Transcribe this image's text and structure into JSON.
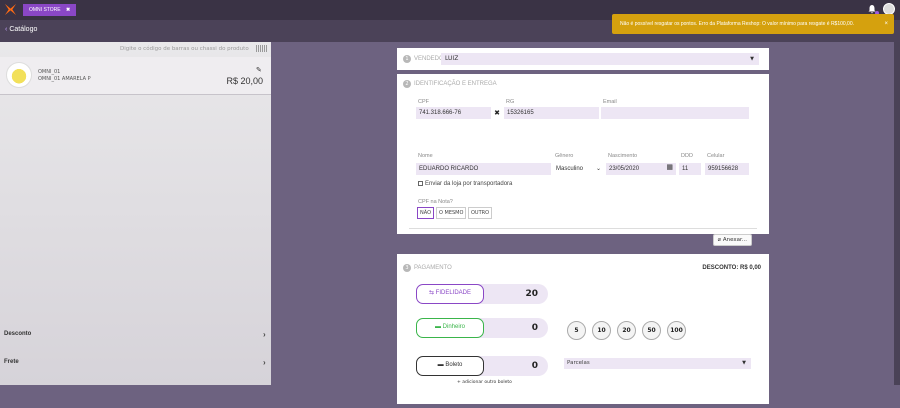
{
  "header": {
    "store_tab": "OMNI STORE",
    "store_tab_close": "✖",
    "back_label": "Catálogo",
    "back_chevron": "‹",
    "toast_message": "Não é possível resgatar os pontos. Erro da Plataforma Reshop: O valor mínimo para resgate é R$100,00.",
    "toast_close": "×"
  },
  "left": {
    "barcode_placeholder": "Digite o código de barras ou chassi do produto",
    "product": {
      "name": "OMNI_01",
      "variant": "OMNI_01 AMARELA P",
      "price": "R$ 20,00",
      "edit_icon": "✎"
    },
    "rows": [
      {
        "label": "Desconto",
        "chevron": "›"
      },
      {
        "label": "Frete",
        "chevron": "›"
      }
    ]
  },
  "vendor": {
    "step": "1",
    "title": "VENDEDOR",
    "value": "LUIZ"
  },
  "ident": {
    "step": "2",
    "title": "IDENTIFICAÇÃO E ENTREGA",
    "cpf_label": "CPF",
    "cpf_value": "741.318.666-76",
    "clear_icon": "✖",
    "rg_label": "RG",
    "rg_value": "15326165",
    "email_label": "Email",
    "email_value": "",
    "nome_label": "Nome",
    "nome_value": "EDUARDO RICARDO",
    "genero_label": "Gênero",
    "genero_value": "Masculino",
    "nascimento_label": "Nascimento",
    "nascimento_value": "23/05/2020",
    "ddd_label": "DDD",
    "ddd_value": "11",
    "celular_label": "Celular",
    "celular_value": "959156628",
    "transport_label": "Enviar da loja por transportadora",
    "cpf_nota_label": "CPF na Nota?",
    "cpf_nota_options": [
      "NÃO",
      "O MESMO",
      "OUTRO"
    ],
    "cpf_nota_selected": "NÃO",
    "anexar_label": "Anexar..."
  },
  "payment": {
    "step": "3",
    "title": "PAGAMENTO",
    "desconto": "DESCONTO: R$ 0,00",
    "methods": [
      {
        "label": "FIDELIDADE",
        "value": "20",
        "icon": "⇆",
        "color": "#8a47c6"
      },
      {
        "label": "Dinheiro",
        "value": "0",
        "icon": "▬",
        "color": "#3ab54a"
      },
      {
        "label": "Boleto",
        "value": "0",
        "icon": "▬",
        "color": "#333333"
      }
    ],
    "quick_amounts": [
      "5",
      "10",
      "20",
      "50",
      "100"
    ],
    "parcelas_label": "Parcelas",
    "add_boleto": "+ adicionar outro boleto"
  }
}
